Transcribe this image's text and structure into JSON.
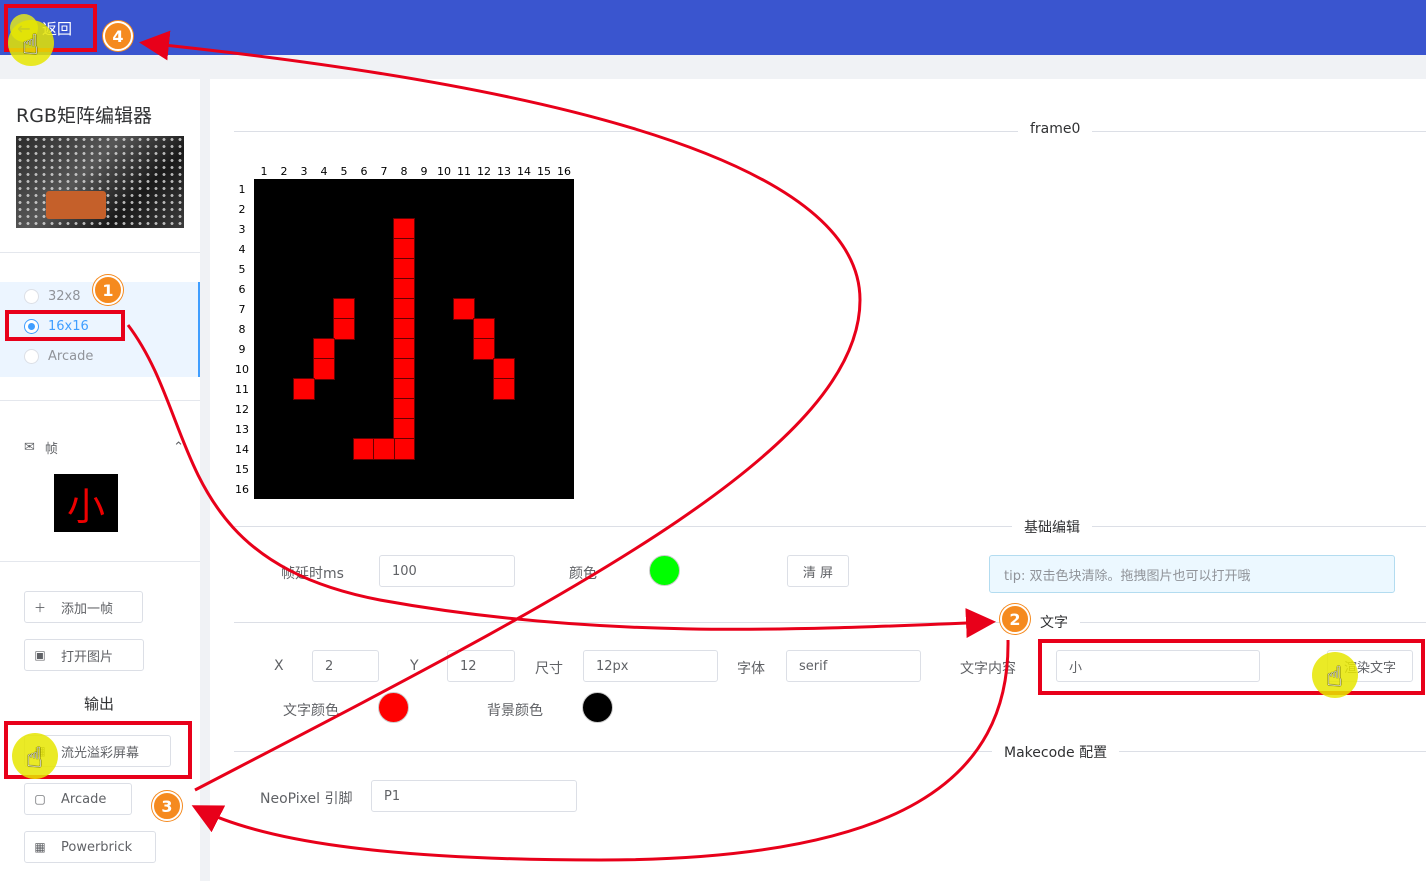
{
  "topbar": {
    "back_label": "返回"
  },
  "sidebar": {
    "title": "RGB矩阵编辑器",
    "sizes": [
      {
        "label": "32x8",
        "checked": false
      },
      {
        "label": "16x16",
        "checked": true
      },
      {
        "label": "Arcade",
        "checked": false
      }
    ],
    "frames_label": "帧",
    "frame_thumb_char": "小",
    "add_frame_label": "添加一帧",
    "open_image_label": "打开图片",
    "output_label": "输出",
    "outputs": [
      "流光溢彩屏幕",
      "Arcade",
      "Powerbrick"
    ]
  },
  "main": {
    "frame_title": "frame0",
    "col_numbers": [
      "1",
      "2",
      "3",
      "4",
      "5",
      "6",
      "7",
      "8",
      "9",
      "10",
      "11",
      "12",
      "13",
      "14",
      "15",
      "16"
    ],
    "row_numbers": [
      "1",
      "2",
      "3",
      "4",
      "5",
      "6",
      "7",
      "8",
      "9",
      "10",
      "11",
      "12",
      "13",
      "14",
      "15",
      "16"
    ],
    "grid_size": 16,
    "lit_color": "#ff0000",
    "lit_cells": [
      [
        3,
        8
      ],
      [
        4,
        8
      ],
      [
        5,
        8
      ],
      [
        6,
        8
      ],
      [
        7,
        8
      ],
      [
        8,
        8
      ],
      [
        9,
        8
      ],
      [
        10,
        8
      ],
      [
        11,
        8
      ],
      [
        12,
        8
      ],
      [
        13,
        8
      ],
      [
        14,
        8
      ],
      [
        14,
        6
      ],
      [
        14,
        7
      ],
      [
        7,
        5
      ],
      [
        8,
        5
      ],
      [
        9,
        4
      ],
      [
        10,
        4
      ],
      [
        11,
        3
      ],
      [
        7,
        11
      ],
      [
        8,
        12
      ],
      [
        9,
        12
      ],
      [
        10,
        13
      ],
      [
        11,
        13
      ]
    ],
    "basic_edit_title": "基础编辑",
    "delay_label": "帧延时ms",
    "delay_value": "100",
    "color_label": "颜色",
    "color_value": "#00ff00",
    "clear_label": "清 屏",
    "tip": "tip: 双击色块清除。拖拽图片也可以打开哦",
    "text_title": "文字",
    "x_label": "X",
    "x_value": "2",
    "y_label": "Y",
    "y_value": "12",
    "size_label": "尺寸",
    "size_value": "12px",
    "font_label": "字体",
    "font_value": "serif",
    "text_content_label": "文字内容",
    "text_content_value": "小",
    "render_text_label": "渲染文字",
    "text_color_label": "文字颜色",
    "text_color_value": "#ff0000",
    "bg_color_label": "背景颜色",
    "bg_color_value": "#000000",
    "makecode_title": "Makecode 配置",
    "neopixel_label": "NeoPixel 引脚",
    "neopixel_value": "P1"
  },
  "annotations": {
    "badges": [
      "1",
      "2",
      "3",
      "4"
    ],
    "color": "#e8001a"
  }
}
